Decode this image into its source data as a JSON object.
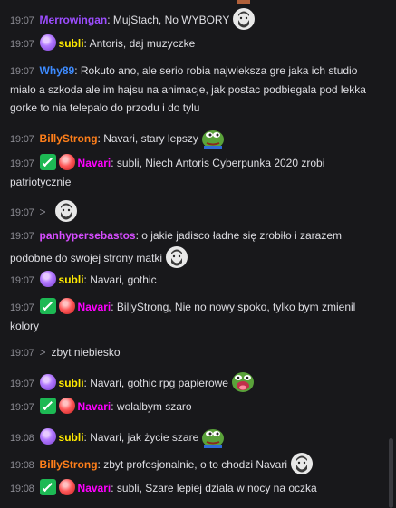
{
  "colors": {
    "background": "#18181b",
    "text": "#dedee3",
    "timestamp": "#8a8a92",
    "user_merrowingan": "#9c4dff",
    "user_subli": "#ffea00",
    "user_why89": "#3d8bff",
    "user_billystrong": "#ff7f1a",
    "user_navari": "#ff00ff",
    "user_panhypersebastos": "#d64dff"
  },
  "messages": [
    {
      "time": "19:07",
      "user": "Merrowingan",
      "text": "MujStach, No WYBORY",
      "emote": "bearded-face-emote"
    },
    {
      "time": "19:07",
      "user": "subli",
      "text": "Antoris, daj muzyczke"
    },
    {
      "time": "19:07",
      "user": "Why89",
      "text": "Rokuto ano, ale serio robia najwieksza gre jaka ich studio mialo a szkoda ale im hajsu na animacje, jak postac podbiegala pod lekka gorke to nia telepalo do przodu i do tylu"
    },
    {
      "time": "19:07",
      "user": "BillyStrong",
      "text": "Navari, stary lepszy",
      "emote": "pepe-emote"
    },
    {
      "time": "19:07",
      "user": "Navari",
      "text": "subli, Niech Antoris Cyberpunka 2020 zrobi patriotycznie"
    },
    {
      "time": "19:07",
      "arrow": ">",
      "emote": "bearded-face-emote"
    },
    {
      "time": "19:07",
      "user": "panhypersebastos",
      "text": "o jakie jadisco ładne się zrobiło i zarazem podobne do swojej strony matki",
      "emote": "bearded-face-emote"
    },
    {
      "time": "19:07",
      "user": "subli",
      "text": "Navari, gothic"
    },
    {
      "time": "19:07",
      "user": "Navari",
      "text": "BillyStrong, Nie no nowy spoko, tylko bym zmienil kolory"
    },
    {
      "time": "19:07",
      "arrow": ">",
      "text": "zbyt niebiesko"
    },
    {
      "time": "19:07",
      "user": "subli",
      "text": "Navari, gothic rpg papierowe",
      "emote": "pepe-scream-emote"
    },
    {
      "time": "19:07",
      "user": "Navari",
      "text": "wolalbym szaro"
    },
    {
      "time": "19:08",
      "user": "subli",
      "text": "Navari, jak życie szare",
      "emote": "pepe-emote"
    },
    {
      "time": "19:08",
      "user": "BillyStrong",
      "text": "zbyt profesjonalnie, o to chodzi Navari",
      "emote": "bearded-face-emote"
    },
    {
      "time": "19:08",
      "user": "Navari",
      "text": "subli, Szare lepiej dziala w nocy na oczka"
    }
  ]
}
